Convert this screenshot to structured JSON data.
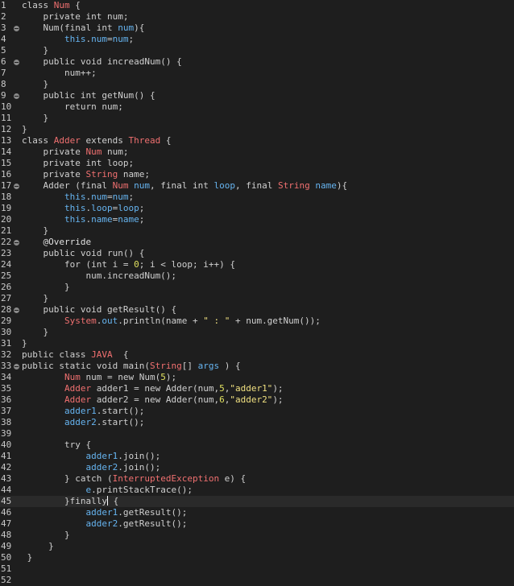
{
  "colors": {
    "background": "#1e1e1e",
    "current_line": "#2a2a2a",
    "keyword": "#d0d0d0",
    "plain": "#d0d0d0",
    "type": "#f07070",
    "field": "#66b4f0",
    "string": "#f0e080",
    "number": "#e0e060",
    "annotation": "#e0e0e0",
    "line_number": "#c9c9c9"
  },
  "editor": {
    "current_line": 45,
    "lines": [
      {
        "n": "1",
        "fold": false,
        "tokens": [
          [
            "k",
            "class "
          ],
          [
            "t",
            "Num"
          ],
          [
            "p",
            " {"
          ]
        ]
      },
      {
        "n": "2",
        "fold": false,
        "tokens": [
          [
            "p",
            "    "
          ],
          [
            "k",
            "private int "
          ],
          [
            "p",
            "num;"
          ]
        ]
      },
      {
        "n": "3",
        "fold": true,
        "tokens": [
          [
            "p",
            "    Num("
          ],
          [
            "k",
            "final int "
          ],
          [
            "f",
            "num"
          ],
          [
            "p",
            "){"
          ]
        ]
      },
      {
        "n": "4",
        "fold": false,
        "tokens": [
          [
            "p",
            "        "
          ],
          [
            "f",
            "this"
          ],
          [
            "p",
            "."
          ],
          [
            "f",
            "num"
          ],
          [
            "p",
            "="
          ],
          [
            "f",
            "num"
          ],
          [
            "p",
            ";"
          ]
        ]
      },
      {
        "n": "5",
        "fold": false,
        "tokens": [
          [
            "p",
            "    }"
          ]
        ]
      },
      {
        "n": "6",
        "fold": true,
        "tokens": [
          [
            "p",
            "    "
          ],
          [
            "k",
            "public void "
          ],
          [
            "p",
            "increadNum() {"
          ]
        ]
      },
      {
        "n": "7",
        "fold": false,
        "tokens": [
          [
            "p",
            "        num++;"
          ]
        ]
      },
      {
        "n": "8",
        "fold": false,
        "tokens": [
          [
            "p",
            "    }"
          ]
        ]
      },
      {
        "n": "9",
        "fold": true,
        "tokens": [
          [
            "p",
            "    "
          ],
          [
            "k",
            "public int "
          ],
          [
            "p",
            "getNum() {"
          ]
        ]
      },
      {
        "n": "10",
        "fold": false,
        "tokens": [
          [
            "p",
            "        "
          ],
          [
            "k",
            "return "
          ],
          [
            "p",
            "num;"
          ]
        ]
      },
      {
        "n": "11",
        "fold": false,
        "tokens": [
          [
            "p",
            "    }"
          ]
        ]
      },
      {
        "n": "12",
        "fold": false,
        "tokens": [
          [
            "p",
            "}"
          ]
        ]
      },
      {
        "n": "13",
        "fold": false,
        "tokens": [
          [
            "k",
            "class "
          ],
          [
            "t",
            "Adder"
          ],
          [
            "k",
            " extends "
          ],
          [
            "t",
            "Thread"
          ],
          [
            "p",
            " {"
          ]
        ]
      },
      {
        "n": "14",
        "fold": false,
        "tokens": [
          [
            "p",
            "    "
          ],
          [
            "k",
            "private "
          ],
          [
            "t",
            "Num"
          ],
          [
            "p",
            " num;"
          ]
        ]
      },
      {
        "n": "15",
        "fold": false,
        "tokens": [
          [
            "p",
            "    "
          ],
          [
            "k",
            "private int "
          ],
          [
            "p",
            "loop;"
          ]
        ]
      },
      {
        "n": "16",
        "fold": false,
        "tokens": [
          [
            "p",
            "    "
          ],
          [
            "k",
            "private "
          ],
          [
            "t",
            "String"
          ],
          [
            "p",
            " name;"
          ]
        ]
      },
      {
        "n": "17",
        "fold": true,
        "tokens": [
          [
            "p",
            "    Adder ("
          ],
          [
            "k",
            "final "
          ],
          [
            "t",
            "Num"
          ],
          [
            "p",
            " "
          ],
          [
            "f",
            "num"
          ],
          [
            "p",
            ", "
          ],
          [
            "k",
            "final int "
          ],
          [
            "f",
            "loop"
          ],
          [
            "p",
            ", "
          ],
          [
            "k",
            "final "
          ],
          [
            "t",
            "String"
          ],
          [
            "p",
            " "
          ],
          [
            "f",
            "name"
          ],
          [
            "p",
            "){"
          ]
        ]
      },
      {
        "n": "18",
        "fold": false,
        "tokens": [
          [
            "p",
            "        "
          ],
          [
            "f",
            "this"
          ],
          [
            "p",
            "."
          ],
          [
            "f",
            "num"
          ],
          [
            "p",
            "="
          ],
          [
            "f",
            "num"
          ],
          [
            "p",
            ";"
          ]
        ]
      },
      {
        "n": "19",
        "fold": false,
        "tokens": [
          [
            "p",
            "        "
          ],
          [
            "f",
            "this"
          ],
          [
            "p",
            "."
          ],
          [
            "f",
            "loop"
          ],
          [
            "p",
            "="
          ],
          [
            "f",
            "loop"
          ],
          [
            "p",
            ";"
          ]
        ]
      },
      {
        "n": "20",
        "fold": false,
        "tokens": [
          [
            "p",
            "        "
          ],
          [
            "f",
            "this"
          ],
          [
            "p",
            "."
          ],
          [
            "f",
            "name"
          ],
          [
            "p",
            "="
          ],
          [
            "f",
            "name"
          ],
          [
            "p",
            ";"
          ]
        ]
      },
      {
        "n": "21",
        "fold": false,
        "tokens": [
          [
            "p",
            "    }"
          ]
        ]
      },
      {
        "n": "22",
        "fold": true,
        "tokens": [
          [
            "p",
            "    "
          ],
          [
            "a",
            "@Override"
          ]
        ]
      },
      {
        "n": "23",
        "fold": false,
        "tokens": [
          [
            "p",
            "    "
          ],
          [
            "k",
            "public void "
          ],
          [
            "p",
            "run() {"
          ]
        ]
      },
      {
        "n": "24",
        "fold": false,
        "tokens": [
          [
            "p",
            "        "
          ],
          [
            "k",
            "for "
          ],
          [
            "p",
            "("
          ],
          [
            "k",
            "int "
          ],
          [
            "p",
            "i = "
          ],
          [
            "num",
            "0"
          ],
          [
            "p",
            "; i < loop; i++) {"
          ]
        ]
      },
      {
        "n": "25",
        "fold": false,
        "tokens": [
          [
            "p",
            "            num.increadNum();"
          ]
        ]
      },
      {
        "n": "26",
        "fold": false,
        "tokens": [
          [
            "p",
            "        }"
          ]
        ]
      },
      {
        "n": "27",
        "fold": false,
        "tokens": [
          [
            "p",
            "    }"
          ]
        ]
      },
      {
        "n": "28",
        "fold": true,
        "tokens": [
          [
            "p",
            "    "
          ],
          [
            "k",
            "public void "
          ],
          [
            "p",
            "getResult() {"
          ]
        ]
      },
      {
        "n": "29",
        "fold": false,
        "tokens": [
          [
            "p",
            "        "
          ],
          [
            "t",
            "System"
          ],
          [
            "p",
            "."
          ],
          [
            "f",
            "out"
          ],
          [
            "p",
            ".println(name + "
          ],
          [
            "s",
            "\" : \""
          ],
          [
            "p",
            " + num.getNum());"
          ]
        ]
      },
      {
        "n": "30",
        "fold": false,
        "tokens": [
          [
            "p",
            "    }"
          ]
        ]
      },
      {
        "n": "31",
        "fold": false,
        "tokens": [
          [
            "p",
            "}"
          ]
        ]
      },
      {
        "n": "32",
        "fold": false,
        "tokens": [
          [
            "k",
            "public class "
          ],
          [
            "t",
            "JAVA"
          ],
          [
            "p",
            "  {"
          ]
        ]
      },
      {
        "n": "33",
        "fold": true,
        "tokens": [
          [
            "k",
            "public static void "
          ],
          [
            "p",
            "main("
          ],
          [
            "t",
            "String"
          ],
          [
            "p",
            "[] "
          ],
          [
            "f",
            "args"
          ],
          [
            "p",
            " ) {"
          ]
        ]
      },
      {
        "n": "34",
        "fold": false,
        "tokens": [
          [
            "p",
            "        "
          ],
          [
            "t",
            "Num"
          ],
          [
            "p",
            " num = "
          ],
          [
            "k",
            "new "
          ],
          [
            "p",
            "Num("
          ],
          [
            "num",
            "5"
          ],
          [
            "p",
            ");"
          ]
        ]
      },
      {
        "n": "35",
        "fold": false,
        "tokens": [
          [
            "p",
            "        "
          ],
          [
            "t",
            "Adder"
          ],
          [
            "p",
            " adder1 = "
          ],
          [
            "k",
            "new "
          ],
          [
            "p",
            "Adder(num,"
          ],
          [
            "num",
            "5"
          ],
          [
            "p",
            ","
          ],
          [
            "s",
            "\"adder1\""
          ],
          [
            "p",
            ");"
          ]
        ]
      },
      {
        "n": "36",
        "fold": false,
        "tokens": [
          [
            "p",
            "        "
          ],
          [
            "t",
            "Adder"
          ],
          [
            "p",
            " adder2 = "
          ],
          [
            "k",
            "new "
          ],
          [
            "p",
            "Adder(num,"
          ],
          [
            "num",
            "6"
          ],
          [
            "p",
            ","
          ],
          [
            "s",
            "\"adder2\""
          ],
          [
            "p",
            ");"
          ]
        ]
      },
      {
        "n": "37",
        "fold": false,
        "tokens": [
          [
            "p",
            "        "
          ],
          [
            "f",
            "adder1"
          ],
          [
            "p",
            ".start();"
          ]
        ]
      },
      {
        "n": "38",
        "fold": false,
        "tokens": [
          [
            "p",
            "        "
          ],
          [
            "f",
            "adder2"
          ],
          [
            "p",
            ".start();"
          ]
        ]
      },
      {
        "n": "39",
        "fold": false,
        "tokens": [
          [
            "p",
            ""
          ]
        ]
      },
      {
        "n": "40",
        "fold": false,
        "tokens": [
          [
            "p",
            "        "
          ],
          [
            "k",
            "try "
          ],
          [
            "p",
            "{"
          ]
        ]
      },
      {
        "n": "41",
        "fold": false,
        "tokens": [
          [
            "p",
            "            "
          ],
          [
            "f",
            "adder1"
          ],
          [
            "p",
            ".join();"
          ]
        ]
      },
      {
        "n": "42",
        "fold": false,
        "tokens": [
          [
            "p",
            "            "
          ],
          [
            "f",
            "adder2"
          ],
          [
            "p",
            ".join();"
          ]
        ]
      },
      {
        "n": "43",
        "fold": false,
        "tokens": [
          [
            "p",
            "        } "
          ],
          [
            "k",
            "catch "
          ],
          [
            "p",
            "("
          ],
          [
            "t",
            "InterruptedException"
          ],
          [
            "p",
            " e) {"
          ]
        ]
      },
      {
        "n": "44",
        "fold": false,
        "tokens": [
          [
            "p",
            "            "
          ],
          [
            "f",
            "e"
          ],
          [
            "p",
            ".printStackTrace();"
          ]
        ]
      },
      {
        "n": "45",
        "fold": false,
        "tokens": [
          [
            "p",
            "        }"
          ],
          [
            "k",
            "finally"
          ],
          [
            "caret",
            ""
          ],
          [
            "p",
            " {"
          ]
        ]
      },
      {
        "n": "46",
        "fold": false,
        "tokens": [
          [
            "p",
            "            "
          ],
          [
            "f",
            "adder1"
          ],
          [
            "p",
            ".getResult();"
          ]
        ]
      },
      {
        "n": "47",
        "fold": false,
        "tokens": [
          [
            "p",
            "            "
          ],
          [
            "f",
            "adder2"
          ],
          [
            "p",
            ".getResult();"
          ]
        ]
      },
      {
        "n": "48",
        "fold": false,
        "tokens": [
          [
            "p",
            "        }"
          ]
        ]
      },
      {
        "n": "49",
        "fold": false,
        "tokens": [
          [
            "p",
            "     }"
          ]
        ]
      },
      {
        "n": "50",
        "fold": false,
        "tokens": [
          [
            "p",
            " }"
          ]
        ]
      },
      {
        "n": "51",
        "fold": false,
        "tokens": [
          [
            "p",
            ""
          ]
        ]
      },
      {
        "n": "52",
        "fold": false,
        "tokens": [
          [
            "p",
            ""
          ]
        ]
      }
    ]
  }
}
